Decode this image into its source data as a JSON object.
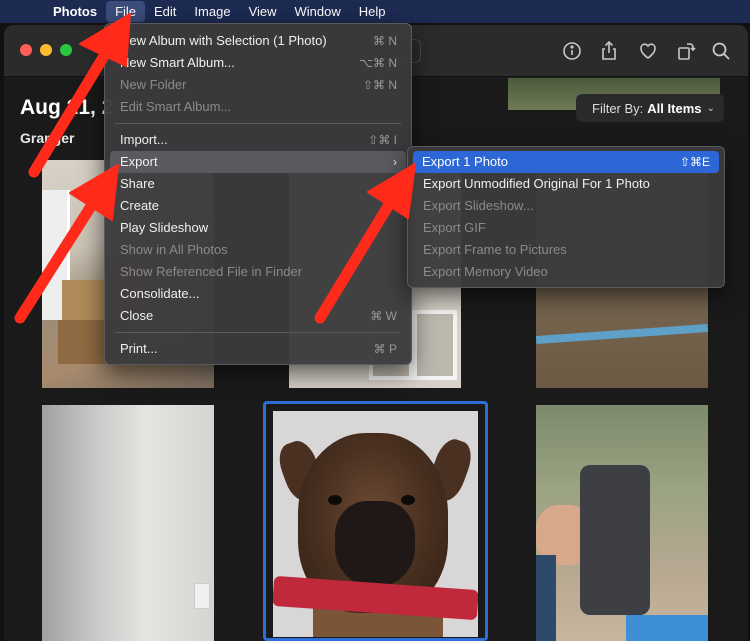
{
  "menubar": {
    "app_name": "Photos",
    "items": [
      "File",
      "Edit",
      "Image",
      "View",
      "Window",
      "Help"
    ]
  },
  "library": {
    "date_title": "Aug 21, 2",
    "location": "Granger",
    "filter_label": "Filter By:",
    "filter_value": "All Items"
  },
  "file_menu": {
    "items": [
      {
        "label": "New Album with Selection (1 Photo)",
        "shortcut": "⌘ N",
        "enabled": true
      },
      {
        "label": "New Smart Album...",
        "shortcut": "⌥⌘ N",
        "enabled": true
      },
      {
        "label": "New Folder",
        "shortcut": "⇧⌘ N",
        "enabled": false
      },
      {
        "label": "Edit Smart Album...",
        "shortcut": "",
        "enabled": false
      },
      {
        "label": "Import...",
        "shortcut": "⇧⌘ I",
        "enabled": true
      },
      {
        "label": "Export",
        "shortcut": "",
        "enabled": true
      },
      {
        "label": "Share",
        "shortcut": "",
        "enabled": true
      },
      {
        "label": "Create",
        "shortcut": "",
        "enabled": true
      },
      {
        "label": "Play Slideshow",
        "shortcut": "",
        "enabled": true
      },
      {
        "label": "Show in All Photos",
        "shortcut": "",
        "enabled": false
      },
      {
        "label": "Show Referenced File in Finder",
        "shortcut": "",
        "enabled": false
      },
      {
        "label": "Consolidate...",
        "shortcut": "",
        "enabled": true
      },
      {
        "label": "Close",
        "shortcut": "⌘ W",
        "enabled": true
      },
      {
        "label": "Print...",
        "shortcut": "⌘ P",
        "enabled": true
      }
    ],
    "submenu_chevron": "›"
  },
  "export_menu": {
    "items": [
      {
        "label": "Export 1 Photo",
        "shortcut": "⇧⌘E",
        "enabled": true
      },
      {
        "label": "Export Unmodified Original For 1 Photo",
        "shortcut": "",
        "enabled": true
      },
      {
        "label": "Export Slideshow...",
        "shortcut": "",
        "enabled": false
      },
      {
        "label": "Export GIF",
        "shortcut": "",
        "enabled": false
      },
      {
        "label": "Export Frame to Pictures",
        "shortcut": "",
        "enabled": false
      },
      {
        "label": "Export Memory Video",
        "shortcut": "",
        "enabled": false
      }
    ]
  },
  "toolbar_icons": [
    "info-icon",
    "share-icon",
    "heart-icon",
    "rotate-icon",
    "search-icon"
  ],
  "colors": {
    "menubar_bg": "#1d2a52",
    "highlight_blue": "#2d67d6",
    "annotation_red": "#ff2a1a",
    "selection_border": "#2d6fd8"
  }
}
